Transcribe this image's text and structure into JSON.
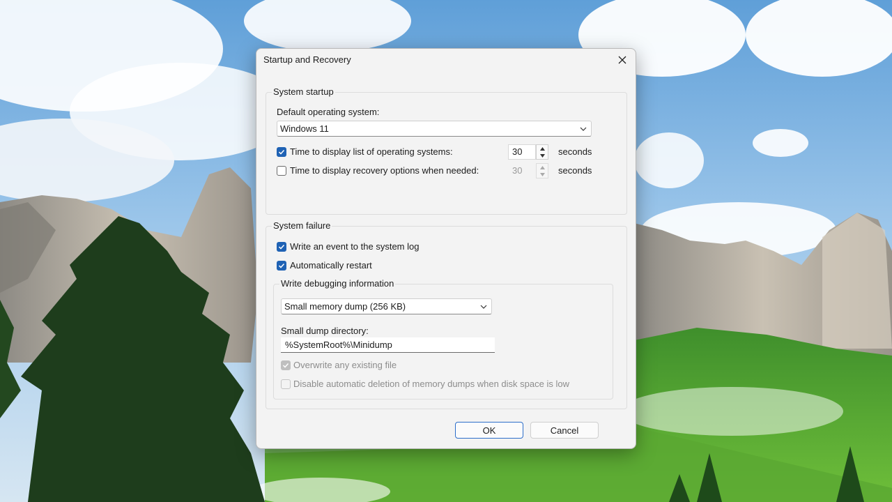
{
  "dialog": {
    "title": "Startup and Recovery",
    "close_icon": "close-icon"
  },
  "system_startup": {
    "group_label": "System startup",
    "default_os_label": "Default operating system:",
    "default_os_value": "Windows 11",
    "display_list": {
      "checked": true,
      "label": "Time to display list of operating systems:",
      "value": "30",
      "unit": "seconds"
    },
    "display_recovery": {
      "checked": false,
      "label": "Time to display recovery options when needed:",
      "value": "30",
      "unit": "seconds"
    }
  },
  "system_failure": {
    "group_label": "System failure",
    "write_event": {
      "checked": true,
      "label": "Write an event to the system log"
    },
    "auto_restart": {
      "checked": true,
      "label": "Automatically restart"
    },
    "debug": {
      "group_label": "Write debugging information",
      "dump_type": "Small memory dump (256 KB)",
      "dir_label": "Small dump directory:",
      "dir_value": "%SystemRoot%\\Minidump",
      "overwrite": {
        "checked": true,
        "enabled": false,
        "label": "Overwrite any existing file"
      },
      "disable_auto_delete": {
        "checked": false,
        "enabled": false,
        "label": "Disable automatic deletion of memory dumps when disk space is low"
      }
    }
  },
  "buttons": {
    "ok": "OK",
    "cancel": "Cancel"
  },
  "colors": {
    "accent": "#1f62b4",
    "dialog_bg": "#f3f3f3"
  }
}
